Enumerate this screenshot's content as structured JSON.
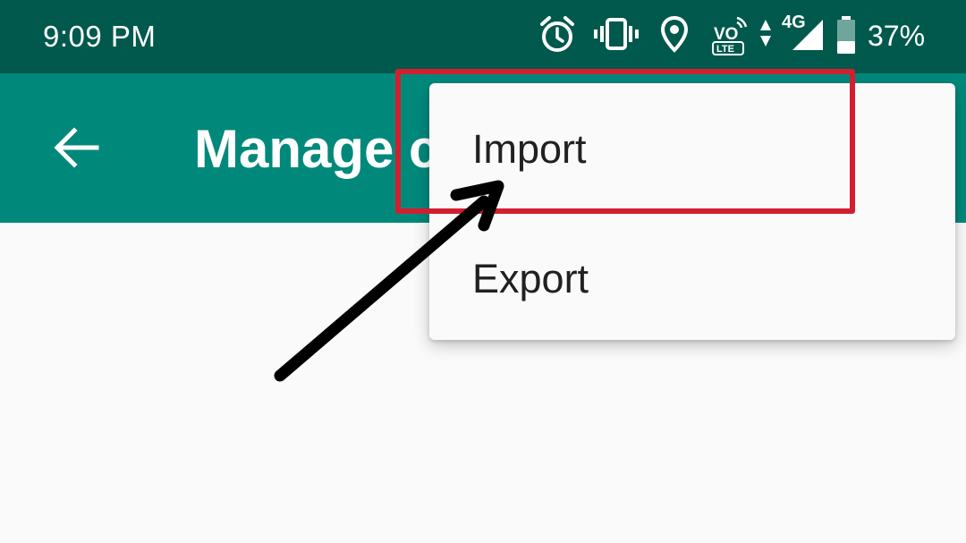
{
  "status_bar": {
    "time": "9:09 PM",
    "network": "4G",
    "volte": "VO",
    "volte_sub": "LTE",
    "battery": "37%",
    "icons": [
      "alarm-icon",
      "vibrate-icon",
      "location-icon",
      "volte-icon",
      "data-activity-icon",
      "signal-icon",
      "battery-icon"
    ]
  },
  "app_bar": {
    "back_icon": "arrow-back-icon",
    "title": "Manage c"
  },
  "menu": {
    "items": [
      {
        "label": "Import"
      },
      {
        "label": "Export"
      }
    ]
  },
  "annotation": {
    "highlight_color": "#d21f30",
    "arrow_color": "#000000"
  },
  "colors": {
    "status_bar": "#00594c",
    "app_bar": "#00897b",
    "background": "#fafafa"
  }
}
